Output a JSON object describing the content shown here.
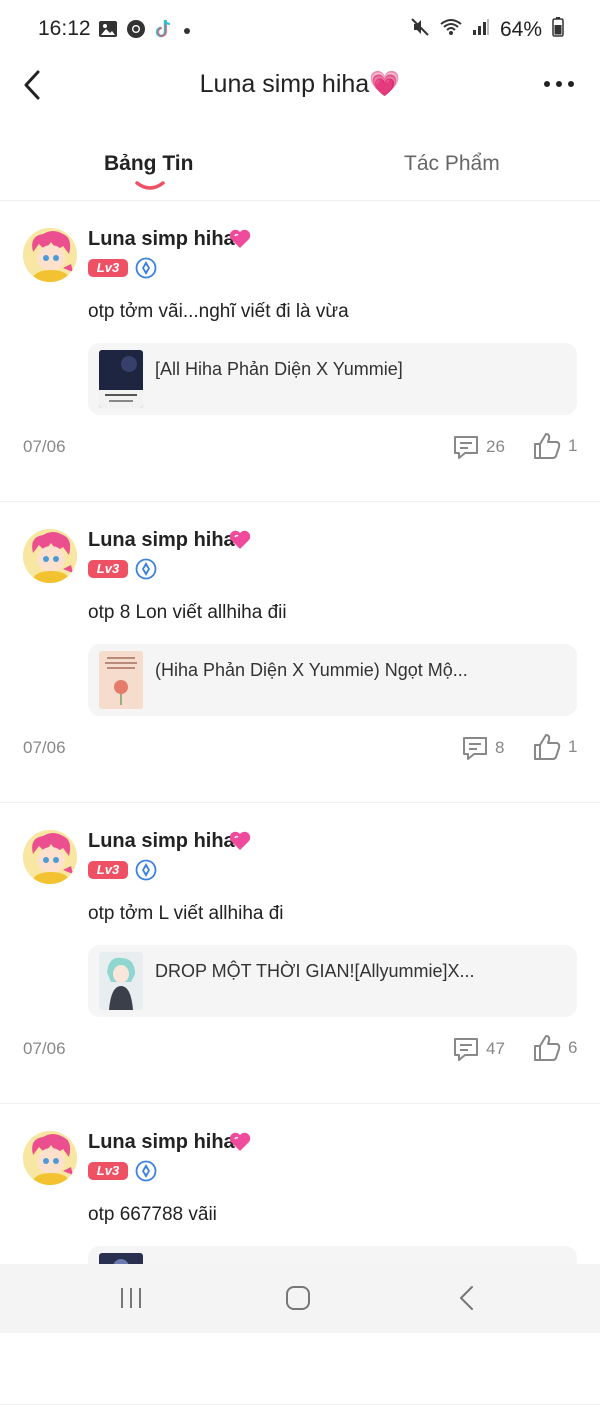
{
  "status_bar": {
    "time": "16:12",
    "battery": "64%",
    "left_icons": [
      "gallery-icon",
      "chrome-icon",
      "tiktok-icon",
      "dot-icon"
    ],
    "right_icons": [
      "mute-icon",
      "wifi-icon",
      "signal-icon",
      "battery-icon"
    ]
  },
  "header": {
    "title": "Luna simp hiha",
    "title_emoji": "💗"
  },
  "tabs": [
    {
      "label": "Bảng Tin",
      "active": true
    },
    {
      "label": "Tác Phẩm",
      "active": false
    }
  ],
  "posts": [
    {
      "username": "Luna simp hiha",
      "level": "Lv3",
      "text": "otp tởm vãi...nghĩ viết đi là vừa",
      "book_title": "[All Hiha Phản Diện X Yummie]",
      "date": "07/06",
      "comments": "26",
      "likes": "1"
    },
    {
      "username": "Luna simp hiha",
      "level": "Lv3",
      "text": "otp 8 Lon viết allhiha đii",
      "book_title": "(Hiha Phản Diện X Yummie) Ngọt Mộ...",
      "date": "07/06",
      "comments": "8",
      "likes": "1"
    },
    {
      "username": "Luna simp hiha",
      "level": "Lv3",
      "text": "otp tởm L viết allhiha đi",
      "book_title": "DROP MỘT THỜI GIAN![Allyummie]X...",
      "date": "07/06",
      "comments": "47",
      "likes": "6"
    },
    {
      "username": "Luna simp hiha",
      "level": "Lv3",
      "text": "otp 667788 vãii"
    }
  ],
  "colors": {
    "accent": "#ee5064",
    "verified": "#3b82e0",
    "card_bg": "#f5f5f5",
    "muted_text": "#888888"
  }
}
